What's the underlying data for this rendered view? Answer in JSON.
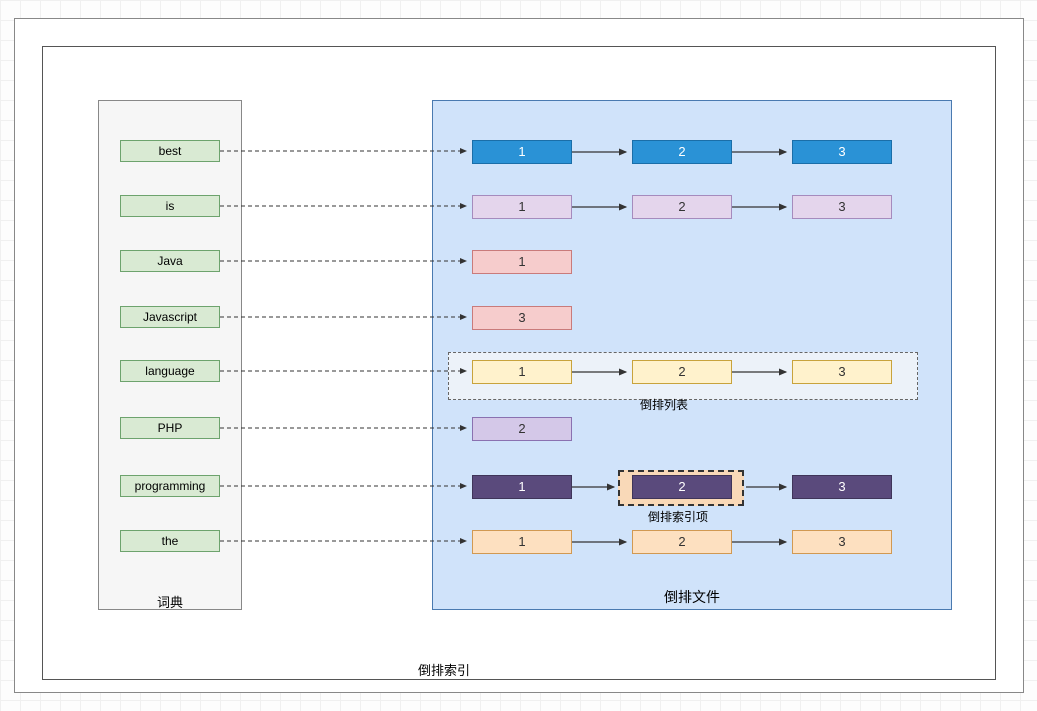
{
  "labels": {
    "dictionary": "词典",
    "file": "倒排文件",
    "list": "倒排列表",
    "item": "倒排索引项",
    "bottom": "倒排索引"
  },
  "terms": [
    "best",
    "is",
    "Java",
    "Javascript",
    "language",
    "PHP",
    "programming",
    "the"
  ],
  "rows": {
    "best": [
      "1",
      "2",
      "3"
    ],
    "is": [
      "1",
      "2",
      "3"
    ],
    "Java": [
      "1"
    ],
    "Javascript": [
      "3"
    ],
    "language": [
      "1",
      "2",
      "3"
    ],
    "PHP": [
      "2"
    ],
    "programming": [
      "1",
      "2",
      "3"
    ],
    "the": [
      "1",
      "2",
      "3"
    ]
  },
  "chart_data": {
    "type": "table",
    "title": "倒排索引 (Inverted Index)",
    "dictionary_label": "词典",
    "postings_file_label": "倒排文件",
    "postings_list_label": "倒排列表",
    "posting_item_label": "倒排索引项",
    "entries": [
      {
        "term": "best",
        "postings": [
          1,
          2,
          3
        ]
      },
      {
        "term": "is",
        "postings": [
          1,
          2,
          3
        ]
      },
      {
        "term": "Java",
        "postings": [
          1
        ]
      },
      {
        "term": "Javascript",
        "postings": [
          3
        ]
      },
      {
        "term": "language",
        "postings": [
          1,
          2,
          3
        ]
      },
      {
        "term": "PHP",
        "postings": [
          2
        ]
      },
      {
        "term": "programming",
        "postings": [
          1,
          2,
          3
        ]
      },
      {
        "term": "the",
        "postings": [
          1,
          2,
          3
        ]
      }
    ],
    "highlighted_list_term": "language",
    "highlighted_item": {
      "term": "programming",
      "doc": 2
    }
  }
}
